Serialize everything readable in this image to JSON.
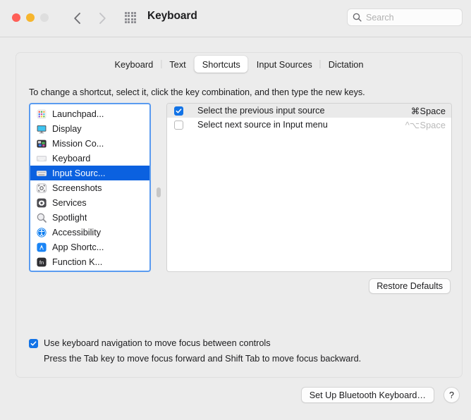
{
  "window": {
    "title": "Keyboard",
    "traffic_lights": [
      "close",
      "minimize",
      "zoom"
    ]
  },
  "toolbar": {
    "back_icon": "chevron-left-icon",
    "forward_icon": "chevron-right-icon",
    "grid_icon": "grid-icon",
    "search": {
      "placeholder": "Search",
      "value": "",
      "icon": "search-icon"
    }
  },
  "tabs": [
    {
      "label": "Keyboard",
      "selected": false
    },
    {
      "label": "Text",
      "selected": false
    },
    {
      "label": "Shortcuts",
      "selected": true
    },
    {
      "label": "Input Sources",
      "selected": false
    },
    {
      "label": "Dictation",
      "selected": false
    }
  ],
  "instruction": "To change a shortcut, select it, click the key combination, and then type the new keys.",
  "sidebar": {
    "items": [
      {
        "label": "Launchpad...",
        "icon": "launchpad-icon",
        "selected": false
      },
      {
        "label": "Display",
        "icon": "display-icon",
        "selected": false
      },
      {
        "label": "Mission Co...",
        "icon": "mission-control-icon",
        "selected": false
      },
      {
        "label": "Keyboard",
        "icon": "keyboard-icon",
        "selected": false
      },
      {
        "label": "Input Sourc...",
        "icon": "input-sources-icon",
        "selected": true
      },
      {
        "label": "Screenshots",
        "icon": "screenshots-icon",
        "selected": false
      },
      {
        "label": "Services",
        "icon": "services-gear-icon",
        "selected": false
      },
      {
        "label": "Spotlight",
        "icon": "spotlight-icon",
        "selected": false
      },
      {
        "label": "Accessibility",
        "icon": "accessibility-icon",
        "selected": false
      },
      {
        "label": "App Shortc...",
        "icon": "app-shortcuts-icon",
        "selected": false
      },
      {
        "label": "Function K...",
        "icon": "function-keys-icon",
        "selected": false
      }
    ]
  },
  "shortcuts": {
    "rows": [
      {
        "name": "Select the previous input source",
        "keys": "⌘Space",
        "checked": true,
        "enabled": true,
        "highlighted": true
      },
      {
        "name": "Select next source in Input menu",
        "keys": "^⌥Space",
        "checked": false,
        "enabled": false,
        "highlighted": false
      }
    ]
  },
  "restore_defaults_label": "Restore Defaults",
  "keyboard_nav": {
    "checked": true,
    "label": "Use keyboard navigation to move focus between controls",
    "help": "Press the Tab key to move focus forward and Shift Tab to move focus backward."
  },
  "footer": {
    "bluetooth_label": "Set Up Bluetooth Keyboard…",
    "help_label": "?"
  },
  "colors": {
    "accent_blue": "#0b61e0",
    "checkbox_blue": "#1273e6",
    "focus_ring": "#5a9bf0",
    "window_bg": "#ececec",
    "traffic_close": "#ff5f57",
    "traffic_min": "#f6b52d",
    "traffic_zoom": "#dedede",
    "disabled_key": "#b9b9b9"
  }
}
